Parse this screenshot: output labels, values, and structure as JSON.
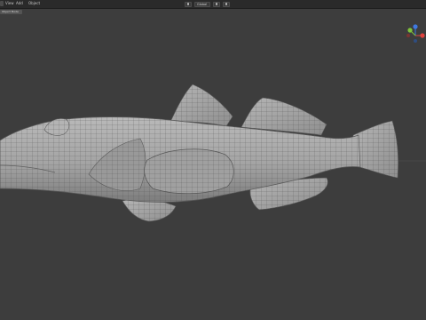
{
  "header": {
    "menus": [
      "View",
      "Add",
      "Object"
    ],
    "mode_label": "Object Mode",
    "orientation_label": "Global"
  },
  "gizmo": {
    "axis_colors": {
      "x": "#e0433f",
      "y": "#7fc33b",
      "z": "#3f79e0"
    },
    "axis_labels": [
      "X",
      "Y",
      "Z"
    ]
  },
  "icons": [
    "pivot-icon",
    "snap-icon",
    "proportional-edit-icon",
    "navigation-gizmo-icon"
  ],
  "colors": {
    "viewport_bg": "#3d3d3d",
    "mesh_fill": "#a8a8a8",
    "wire": "#4a4a4a"
  }
}
